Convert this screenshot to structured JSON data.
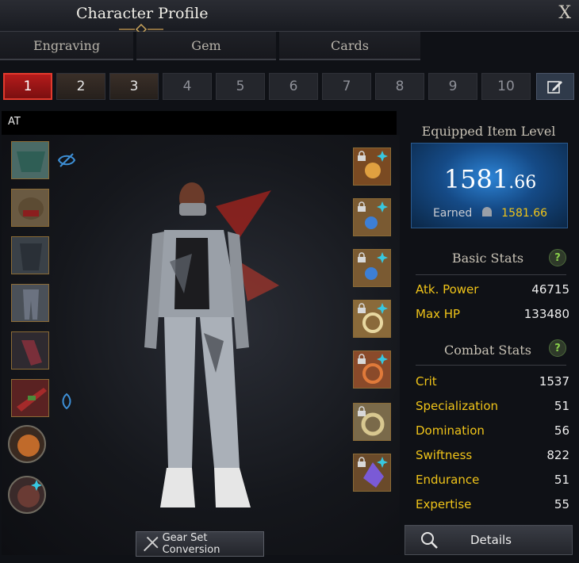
{
  "window": {
    "title": "Character Profile",
    "close_label": "X"
  },
  "tabs": [
    {
      "label": "Engraving"
    },
    {
      "label": "Gem"
    },
    {
      "label": "Cards"
    }
  ],
  "presets": [
    "1",
    "2",
    "3",
    "4",
    "5",
    "6",
    "7",
    "8",
    "9",
    "10"
  ],
  "active_preset": "1",
  "character": {
    "name_label": "AT"
  },
  "gear_set_button": "Gear Set Conversion",
  "item_level": {
    "title": "Equipped Item Level",
    "int": "1581",
    "dec": ".66",
    "earned_label": "Earned",
    "earned_value": "1581.66"
  },
  "basic_stats": {
    "title": "Basic Stats",
    "help": "?",
    "rows": [
      {
        "label": "Atk. Power",
        "value": "46715"
      },
      {
        "label": "Max HP",
        "value": "133480"
      }
    ]
  },
  "combat_stats": {
    "title": "Combat Stats",
    "help": "?",
    "rows": [
      {
        "label": "Crit",
        "value": "1537"
      },
      {
        "label": "Specialization",
        "value": "51"
      },
      {
        "label": "Domination",
        "value": "56"
      },
      {
        "label": "Swiftness",
        "value": "822"
      },
      {
        "label": "Endurance",
        "value": "51"
      },
      {
        "label": "Expertise",
        "value": "55"
      }
    ]
  },
  "details_button": "Details",
  "colors": {
    "accent_gold": "#f0c419",
    "active_red": "#b51b1b",
    "level_blue": "#2d84d6"
  },
  "icons": {
    "left_slots": [
      "shoulder-armor-icon",
      "helmet-icon",
      "chest-armor-icon",
      "pants-icon",
      "gloves-icon",
      "weapon-icon",
      "ability-stone-icon",
      "bracelet-icon"
    ],
    "right_slots": [
      "necklace-icon",
      "earring-icon",
      "earring-icon",
      "ring-icon",
      "ring-icon",
      "bracelet-accessory-icon",
      "gem-crystal-icon"
    ]
  }
}
